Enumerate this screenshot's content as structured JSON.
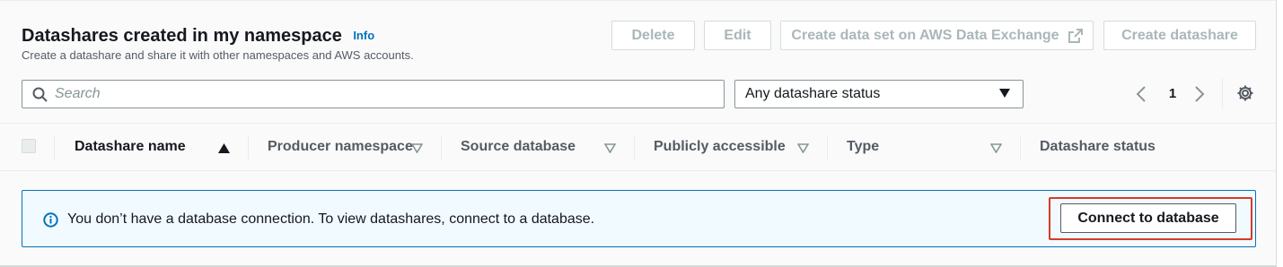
{
  "header": {
    "title": "Datashares created in my namespace",
    "info_label": "Info",
    "subtitle": "Create a datashare and share it with other namespaces and AWS accounts."
  },
  "actions": {
    "delete_label": "Delete",
    "edit_label": "Edit",
    "exchange_label": "Create data set on AWS Data Exchange",
    "create_label": "Create datashare"
  },
  "filters": {
    "search_placeholder": "Search",
    "status_select_value": "Any datashare status"
  },
  "pagination": {
    "current_page": "1"
  },
  "table": {
    "columns": [
      "Datashare name",
      "Producer namespace",
      "Source database",
      "Publicly accessible",
      "Type",
      "Datashare status"
    ]
  },
  "alert": {
    "message": "You don’t have a database connection. To view datashares, connect to a database.",
    "button_label": "Connect to database"
  },
  "colors": {
    "link": "#0073bb",
    "alert_border": "#0073bb",
    "alert_background": "#f1faff",
    "highlight": "#d63a2a"
  },
  "icons": {
    "info": "info-circle-icon",
    "search": "search-icon",
    "external": "external-link-icon",
    "settings": "gear-icon",
    "prev": "chevron-left-icon",
    "next": "chevron-right-icon",
    "dropdown": "caret-down-icon",
    "sort_asc": "sort-ascending-icon",
    "sort": "sort-caret-icon"
  }
}
